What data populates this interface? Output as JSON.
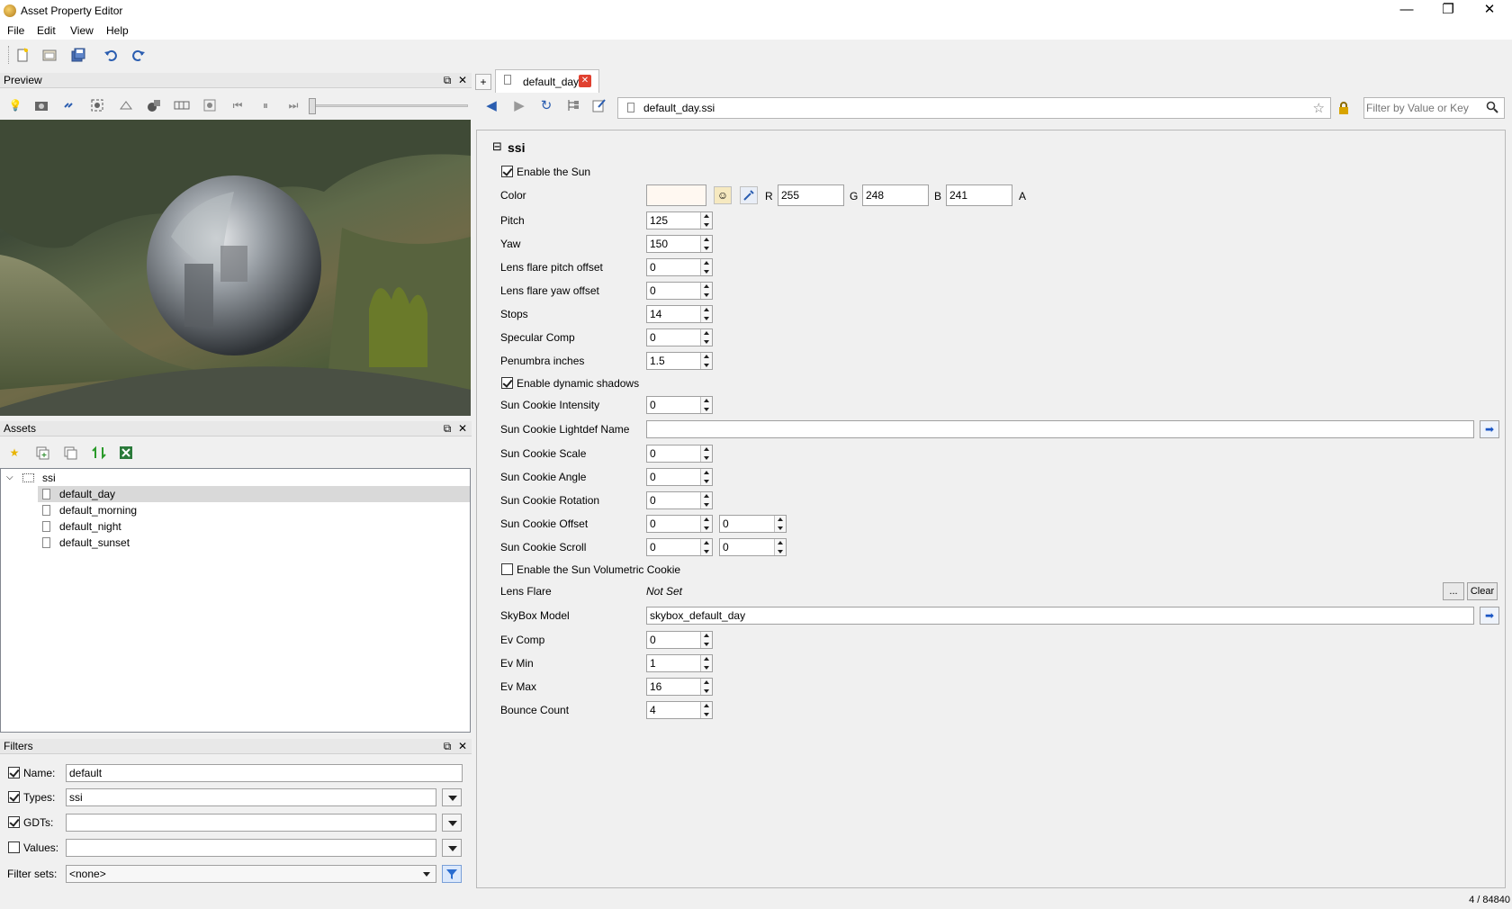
{
  "window": {
    "title": "Asset Property Editor",
    "minimize": "—",
    "restore": "❐",
    "close": "✕"
  },
  "menu": {
    "file": "File",
    "edit": "Edit",
    "view": "View",
    "help": "Help"
  },
  "preview": {
    "title": "Preview"
  },
  "assets": {
    "title": "Assets",
    "root": "ssi",
    "items": [
      "default_day",
      "default_morning",
      "default_night",
      "default_sunset"
    ],
    "selected": "default_day"
  },
  "filters": {
    "title": "Filters",
    "name_label": "Name:",
    "name_value": "default",
    "types_label": "Types:",
    "types_value": "ssi",
    "gdts_label": "GDTs:",
    "gdts_value": "",
    "values_label": "Values:",
    "values_value": "",
    "filtersets_label": "Filter sets:",
    "filtersets_value": "<none>"
  },
  "tab": {
    "label": "default_day",
    "add": "+"
  },
  "address": {
    "value": "default_day.ssi"
  },
  "search": {
    "placeholder": "Filter by Value or Key"
  },
  "section": {
    "title": "ssi",
    "collapse": "⊟"
  },
  "props": {
    "enable_sun": "Enable the Sun",
    "color_label": "Color",
    "r_label": "R",
    "r_value": "255",
    "g_label": "G",
    "g_value": "248",
    "b_label": "B",
    "b_value": "241",
    "a_label": "A",
    "pitch_label": "Pitch",
    "pitch_value": "125",
    "yaw_label": "Yaw",
    "yaw_value": "150",
    "lf_pitch_label": "Lens flare pitch offset",
    "lf_pitch_value": "0",
    "lf_yaw_label": "Lens flare yaw offset",
    "lf_yaw_value": "0",
    "stops_label": "Stops",
    "stops_value": "14",
    "spec_label": "Specular Comp",
    "spec_value": "0",
    "penumbra_label": "Penumbra inches",
    "penumbra_value": "1.5",
    "dyn_shadows": "Enable dynamic shadows",
    "sc_int_label": "Sun Cookie Intensity",
    "sc_int_value": "0",
    "sc_lightdef_label": "Sun Cookie Lightdef Name",
    "sc_lightdef_value": "",
    "sc_scale_label": "Sun Cookie Scale",
    "sc_scale_value": "0",
    "sc_angle_label": "Sun Cookie Angle",
    "sc_angle_value": "0",
    "sc_rot_label": "Sun Cookie Rotation",
    "sc_rot_value": "0",
    "sc_offset_label": "Sun Cookie Offset",
    "sc_offset_x": "0",
    "sc_offset_y": "0",
    "sc_scroll_label": "Sun Cookie Scroll",
    "sc_scroll_x": "0",
    "sc_scroll_y": "0",
    "vol_cookie": "Enable the Sun Volumetric Cookie",
    "lens_flare_label": "Lens Flare",
    "lens_flare_value": "Not Set",
    "browse_btn": "...",
    "clear_btn": "Clear",
    "skybox_label": "SkyBox Model",
    "skybox_value": "skybox_default_day",
    "ev_comp_label": "Ev Comp",
    "ev_comp_value": "0",
    "ev_min_label": "Ev Min",
    "ev_min_value": "1",
    "ev_max_label": "Ev Max",
    "ev_max_value": "16",
    "bounce_label": "Bounce Count",
    "bounce_value": "4"
  },
  "status": {
    "count": "4 / 84840"
  },
  "colors": {
    "swatch": "#fff8f1",
    "selection": "#d9d9d9",
    "close_tab": "#e0402f"
  }
}
